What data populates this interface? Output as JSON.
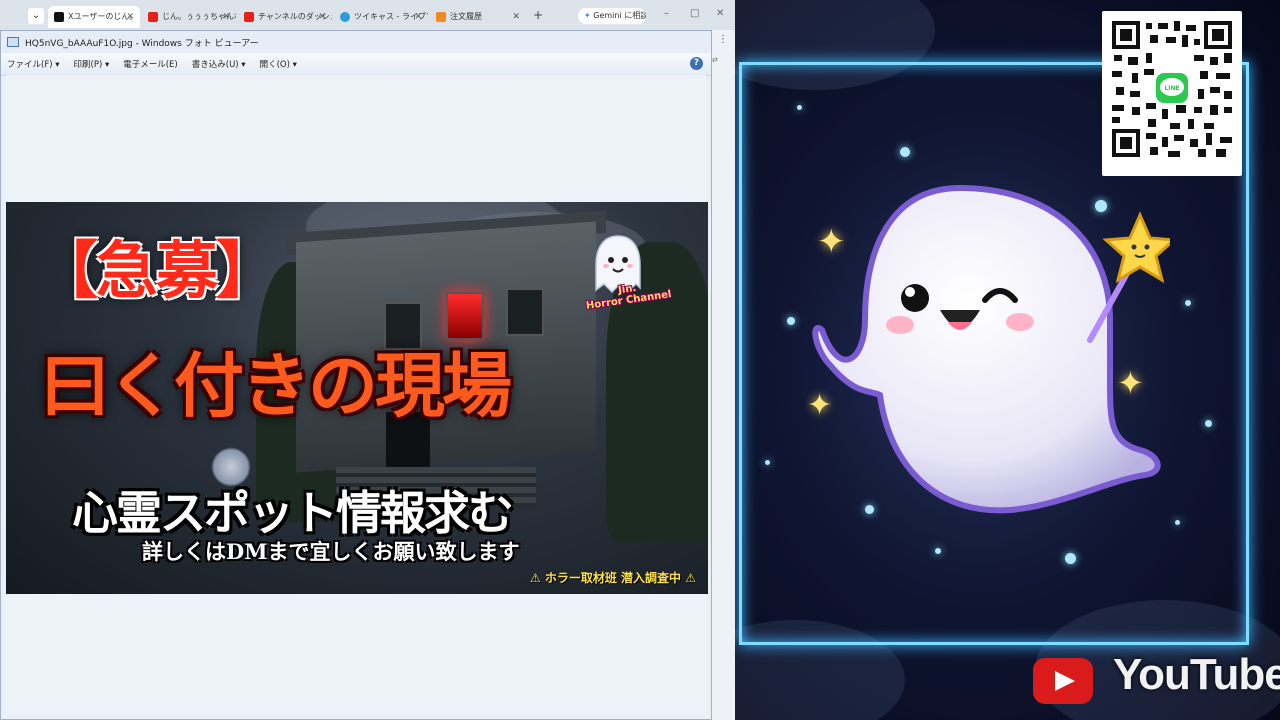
{
  "browser": {
    "tabs": [
      {
        "label": "Xユーザーのじん。",
        "favicon_color": "#111111",
        "active": true
      },
      {
        "label": "じん。ぅぅぅちゃんねる",
        "favicon_color": "#e62117",
        "active": false
      },
      {
        "label": "チャンネルのダッシュボード",
        "favicon_color": "#e62117",
        "active": false
      },
      {
        "label": "ツイキャス - ライブでつな",
        "favicon_color": "#2d9cdb",
        "active": false
      },
      {
        "label": "注文履歴",
        "favicon_color": "#f08a24",
        "active": false
      }
    ],
    "new_tab": "+",
    "gemini_label": "Gemini に相談",
    "window_controls": [
      "–",
      "□",
      "✕"
    ]
  },
  "viewer": {
    "title": "HQ5nVG_bAAAuF1O.jpg - Windows フォト ビューアー",
    "menu": [
      "ファイル(F) ▾",
      "印刷(P) ▾",
      "電子メール(E)",
      "書き込み(U) ▾",
      "開く(O) ▾"
    ],
    "help": "?"
  },
  "thumbnail": {
    "tag": "【急募】",
    "title": "曰く付きの現場",
    "subtitle": "心霊スポット情報求む",
    "detail": "詳しくはDMまで宜しくお願い致します",
    "badge": "⚠ ホラー取材班 潜入調査中 ⚠",
    "mascot_line1": "Jin.",
    "mascot_line2": "Horror Channel"
  },
  "overlay": {
    "youtube_text": "YouTube",
    "qr_badge_text": "LINE",
    "frame_color": "#7fdcff"
  }
}
